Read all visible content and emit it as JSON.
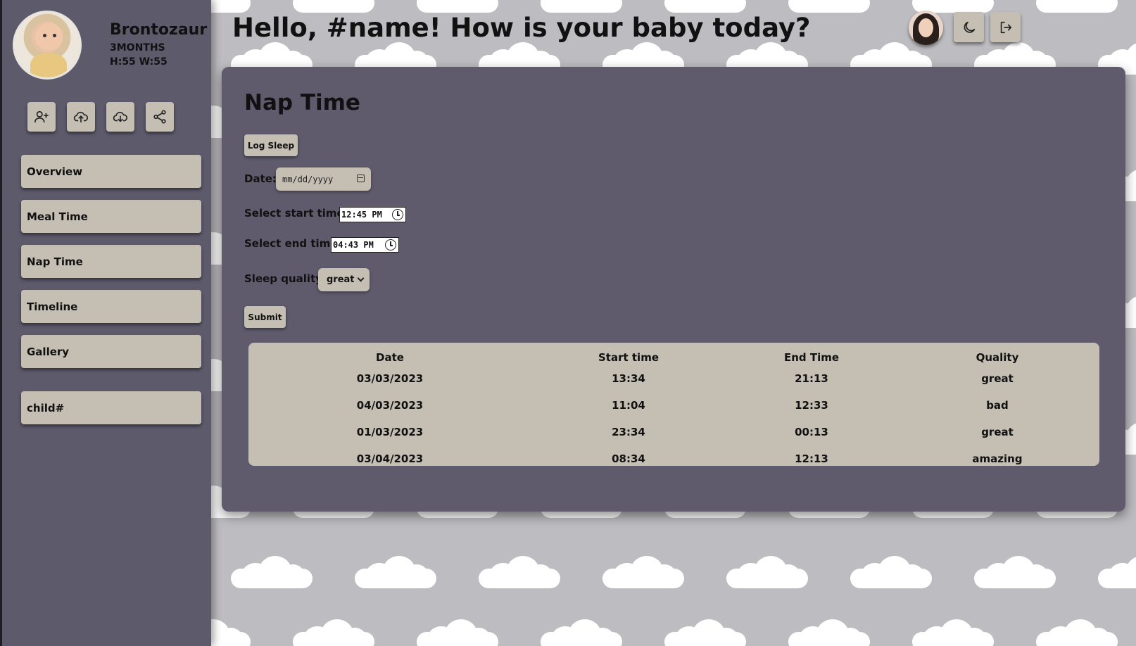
{
  "profile": {
    "baby_name": "Brontozaur",
    "age": "3MONTHS",
    "measurements": "H:55 W:55"
  },
  "sidebar": {
    "actions": [
      {
        "icon": "add-user-icon"
      },
      {
        "icon": "cloud-upload-icon"
      },
      {
        "icon": "cloud-download-icon"
      },
      {
        "icon": "share-icon"
      }
    ],
    "nav_items": [
      {
        "label": "Overview"
      },
      {
        "label": "Meal Time"
      },
      {
        "label": "Nap Time"
      },
      {
        "label": "Timeline"
      },
      {
        "label": "Gallery"
      }
    ],
    "child_item": {
      "label": "child#"
    }
  },
  "header": {
    "greeting": "Hello, #name! How is your baby today?",
    "theme_icon": "moon-icon",
    "logout_icon": "logout-icon"
  },
  "nap": {
    "title": "Nap Time",
    "log_sleep_label": "Log Sleep",
    "date_label": "Date:",
    "date_placeholder": "mm/dd/yyyy",
    "start_label": "Select start time:",
    "start_value": "12:45 PM",
    "end_label": "Select end time:",
    "end_value": "04:43 PM",
    "quality_label": "Sleep quality:",
    "quality_value": "great",
    "submit_label": "Submit"
  },
  "table": {
    "headers": [
      "Date",
      "Start time",
      "End Time",
      "Quality"
    ],
    "rows": [
      [
        "03/03/2023",
        "13:34",
        "21:13",
        "great"
      ],
      [
        "04/03/2023",
        "11:04",
        "12:33",
        "bad"
      ],
      [
        "01/03/2023",
        "23:34",
        "00:13",
        "great"
      ],
      [
        "03/04/2023",
        "08:34",
        "12:13",
        "amazing"
      ]
    ]
  },
  "colors": {
    "sidebar": "#5d5a6c",
    "panel": "#5f5b6d",
    "button": "#c4beb3",
    "background": "#bdbcc0"
  }
}
